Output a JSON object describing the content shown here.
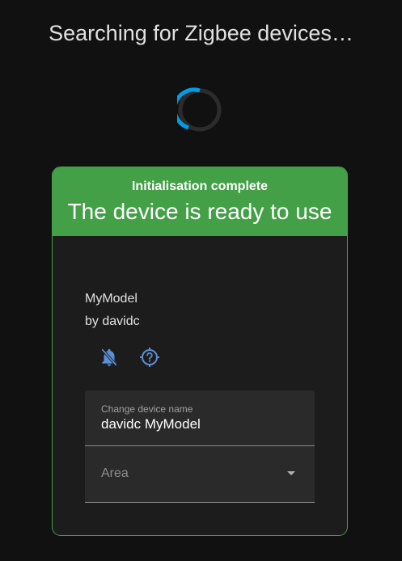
{
  "page": {
    "title": "Searching for Zigbee devices…"
  },
  "colors": {
    "background": "#111111",
    "spinner_arc": "#039be5",
    "spinner_track": "#2c2c2c",
    "success": "#43a047",
    "card": "#1c1c1c",
    "icon": "#5b8fd6"
  },
  "card": {
    "status_line": "Initialisation complete",
    "status_message": "The device is ready to use",
    "model": "MyModel",
    "manufacturer": "by davidc",
    "icons": [
      "notifications-off-icon",
      "identify-icon"
    ],
    "name_field": {
      "label": "Change device name",
      "value": "davidc MyModel"
    },
    "area_field": {
      "placeholder": "Area"
    }
  }
}
